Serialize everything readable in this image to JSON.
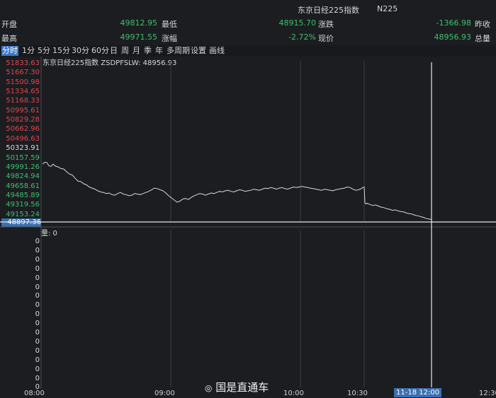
{
  "header": {
    "title": "东京日经225指数",
    "code": "N225"
  },
  "quote_rows": [
    [
      {
        "label": "开盘",
        "value": "49812.95",
        "color": "green"
      },
      {
        "label": "最低",
        "value": "48915.70",
        "color": "green"
      },
      {
        "label": "涨跌",
        "value": "-1366.98",
        "color": "green"
      },
      {
        "label": "昨收",
        "value": "",
        "color": "white"
      }
    ],
    [
      {
        "label": "最高",
        "value": "49971.55",
        "color": "green"
      },
      {
        "label": "涨幅",
        "value": "-2.72%",
        "color": "green"
      },
      {
        "label": "现价",
        "value": "48956.93",
        "color": "green"
      },
      {
        "label": "总量",
        "value": "",
        "color": "white"
      }
    ]
  ],
  "toolbar": [
    "分时",
    "1分",
    "5分",
    "15分",
    "30分",
    "60分",
    "日",
    "周",
    "月",
    "季",
    "年",
    "多周期",
    "设置",
    "画线"
  ],
  "active_tab": "分时",
  "chart_title": "东京日经225指数 ZSDPFSLW: 48956.93",
  "volume_label": "量: 0",
  "current_price_tag": "48897.36",
  "cursor_time": "11-18 12:00",
  "watermark": "国是直通车",
  "colors": {
    "up": "#e0454b",
    "down": "#3fc06a",
    "line": "#d8d8d8",
    "bg": "#1b1d21",
    "grid": "#3a3d42"
  },
  "chart_data": {
    "type": "line",
    "title": "东京日经225指数 ZSDPFSLW: 48956.93",
    "y_ticks": [
      "51833.63",
      "51667.30",
      "51500.98",
      "51334.65",
      "51168.33",
      "50995.61",
      "50829.28",
      "50662.96",
      "50496.63",
      "50323.91",
      "50157.59",
      "49991.26",
      "49824.94",
      "49658.61",
      "49485.89",
      "49319.56",
      "49153.24",
      "48986.91"
    ],
    "ylim": [
      48897.36,
      51833.63
    ],
    "x_ticks": [
      "08:00",
      "09:00",
      "10:00",
      "10:30",
      "12:30"
    ],
    "volume_ticks": [
      "0",
      "0",
      "0",
      "0",
      "0",
      "0",
      "0",
      "0",
      "0",
      "0",
      "0",
      "0",
      "0",
      "0",
      "0",
      "0",
      "0"
    ],
    "series": [
      {
        "values": [
          [
            0,
            49960
          ],
          [
            3,
            49995
          ],
          [
            6,
            49990
          ],
          [
            9,
            49930
          ],
          [
            12,
            49920
          ],
          [
            15,
            49960
          ],
          [
            18,
            49925
          ],
          [
            22,
            49910
          ],
          [
            26,
            49880
          ],
          [
            30,
            49870
          ],
          [
            34,
            49820
          ],
          [
            38,
            49780
          ],
          [
            42,
            49760
          ],
          [
            46,
            49700
          ],
          [
            50,
            49650
          ],
          [
            54,
            49640
          ],
          [
            58,
            49600
          ],
          [
            62,
            49580
          ],
          [
            66,
            49540
          ],
          [
            70,
            49520
          ],
          [
            74,
            49500
          ],
          [
            78,
            49470
          ],
          [
            82,
            49450
          ],
          [
            86,
            49440
          ],
          [
            90,
            49420
          ],
          [
            94,
            49430
          ],
          [
            98,
            49400
          ],
          [
            102,
            49390
          ],
          [
            106,
            49420
          ],
          [
            110,
            49440
          ],
          [
            114,
            49410
          ],
          [
            118,
            49400
          ],
          [
            122,
            49380
          ],
          [
            126,
            49390
          ],
          [
            130,
            49420
          ],
          [
            134,
            49410
          ],
          [
            138,
            49400
          ],
          [
            142,
            49420
          ],
          [
            146,
            49440
          ],
          [
            150,
            49460
          ],
          [
            154,
            49490
          ],
          [
            158,
            49520
          ],
          [
            162,
            49510
          ],
          [
            166,
            49490
          ],
          [
            170,
            49470
          ],
          [
            174,
            49430
          ],
          [
            178,
            49380
          ],
          [
            182,
            49340
          ],
          [
            186,
            49300
          ],
          [
            190,
            49260
          ],
          [
            194,
            49280
          ],
          [
            198,
            49320
          ],
          [
            202,
            49330
          ],
          [
            206,
            49310
          ],
          [
            210,
            49350
          ],
          [
            214,
            49380
          ],
          [
            218,
            49400
          ],
          [
            222,
            49420
          ],
          [
            226,
            49410
          ],
          [
            230,
            49390
          ],
          [
            234,
            49410
          ],
          [
            238,
            49430
          ],
          [
            242,
            49420
          ],
          [
            246,
            49440
          ],
          [
            250,
            49460
          ],
          [
            254,
            49450
          ],
          [
            258,
            49470
          ],
          [
            262,
            49480
          ],
          [
            266,
            49460
          ],
          [
            270,
            49450
          ],
          [
            274,
            49470
          ],
          [
            278,
            49490
          ],
          [
            282,
            49480
          ],
          [
            286,
            49460
          ],
          [
            290,
            49470
          ],
          [
            294,
            49480
          ],
          [
            298,
            49500
          ],
          [
            302,
            49490
          ],
          [
            306,
            49480
          ],
          [
            310,
            49500
          ],
          [
            314,
            49520
          ],
          [
            318,
            49510
          ],
          [
            322,
            49530
          ],
          [
            326,
            49520
          ],
          [
            330,
            49500
          ],
          [
            334,
            49520
          ],
          [
            338,
            49530
          ],
          [
            342,
            49510
          ],
          [
            346,
            49500
          ],
          [
            350,
            49520
          ],
          [
            354,
            49540
          ],
          [
            358,
            49530
          ],
          [
            362,
            49540
          ],
          [
            366,
            49550
          ],
          [
            370,
            49540
          ],
          [
            374,
            49530
          ],
          [
            378,
            49520
          ],
          [
            382,
            49510
          ],
          [
            386,
            49500
          ],
          [
            390,
            49490
          ],
          [
            394,
            49480
          ],
          [
            398,
            49500
          ],
          [
            402,
            49490
          ],
          [
            406,
            49480
          ],
          [
            410,
            49470
          ],
          [
            414,
            49490
          ],
          [
            418,
            49500
          ],
          [
            422,
            49510
          ],
          [
            426,
            49520
          ],
          [
            430,
            49540
          ],
          [
            434,
            49530
          ],
          [
            438,
            49500
          ],
          [
            442,
            49480
          ],
          [
            446,
            49490
          ],
          [
            448,
            49500
          ],
          [
            450,
            49510
          ],
          [
            452,
            49530
          ],
          [
            454,
            49540
          ],
          [
            455,
            49250
          ],
          [
            456,
            49230
          ],
          [
            458,
            49240
          ],
          [
            462,
            49220
          ],
          [
            466,
            49200
          ],
          [
            470,
            49210
          ],
          [
            474,
            49190
          ],
          [
            478,
            49170
          ],
          [
            482,
            49160
          ],
          [
            486,
            49140
          ],
          [
            490,
            49130
          ],
          [
            494,
            49110
          ],
          [
            498,
            49120
          ],
          [
            502,
            49100
          ],
          [
            506,
            49090
          ],
          [
            510,
            49080
          ],
          [
            514,
            49060
          ],
          [
            518,
            49050
          ],
          [
            522,
            49040
          ],
          [
            526,
            49020
          ],
          [
            530,
            49010
          ],
          [
            534,
            48995
          ],
          [
            538,
            48980
          ],
          [
            542,
            48960
          ],
          [
            546,
            48950
          ],
          [
            549,
            48940
          ]
        ]
      }
    ]
  }
}
